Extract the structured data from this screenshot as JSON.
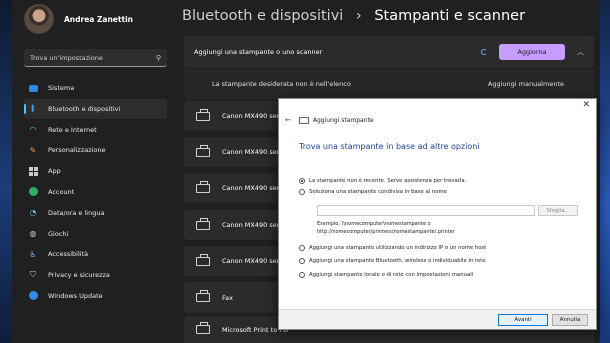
{
  "profile": {
    "name": "Andrea Zanettin"
  },
  "search": {
    "placeholder": "Trova un'impostazione"
  },
  "sidebar": {
    "items": [
      {
        "label": "Sistema",
        "icon": "system-icon"
      },
      {
        "label": "Bluetooth e dispositivi",
        "icon": "bluetooth-icon",
        "active": true
      },
      {
        "label": "Rete e Internet",
        "icon": "wifi-icon"
      },
      {
        "label": "Personalizzazione",
        "icon": "brush-icon"
      },
      {
        "label": "App",
        "icon": "apps-icon"
      },
      {
        "label": "Account",
        "icon": "account-icon"
      },
      {
        "label": "Data/ora e lingua",
        "icon": "globe-clock-icon"
      },
      {
        "label": "Giochi",
        "icon": "gamepad-icon"
      },
      {
        "label": "Accessibilità",
        "icon": "accessibility-icon"
      },
      {
        "label": "Privacy e sicurezza",
        "icon": "shield-icon"
      },
      {
        "label": "Windows Update",
        "icon": "update-icon"
      }
    ]
  },
  "breadcrumb": {
    "parent": "Bluetooth e dispositivi",
    "separator": "›",
    "current": "Stampanti e scanner"
  },
  "add_section": {
    "label": "Aggiungi una stampante o uno scanner",
    "refresh_button": "Aggiorna",
    "manual_text": "La stampante desiderata non è nell'elenco",
    "manual_button": "Aggiungi manualmente"
  },
  "printers": [
    {
      "name": "Canon MX490 series"
    },
    {
      "name": "Canon MX490 series"
    },
    {
      "name": "Canon MX490 series"
    },
    {
      "name": "Canon MX490 series"
    },
    {
      "name": "Canon MX490 series"
    },
    {
      "name": "Fax"
    },
    {
      "name": "Microsoft Print to PD"
    }
  ],
  "dialog": {
    "close": "✕",
    "title": "Aggiungi stampante",
    "heading": "Trova una stampante in base ad altre opzioni",
    "options": [
      {
        "label": "La stampante non è recente. Serve assistenza per trovarla.",
        "selected": true
      },
      {
        "label": "Seleziona una stampante condivisa in base al nome",
        "selected": false
      }
    ],
    "browse_button": "Sfoglia...",
    "example_line1": "Esempio: \\\\nomecomputer\\nomestampante o",
    "example_line2": "http://nomecomputer/printers/nomestampante/.printer",
    "options2": [
      {
        "label": "Aggiungi una stampante utilizzando un indirizzo IP o un nome host",
        "selected": false
      },
      {
        "label": "Aggiungi una stampante Bluetooth, wireless o individuabile in rete",
        "selected": false
      },
      {
        "label": "Aggiungi stampante locale o di rete con impostazioni manuali",
        "selected": false
      }
    ],
    "next_button": "Avanti",
    "cancel_button": "Annulla"
  },
  "colors": {
    "accent": "#c69cff",
    "link_blue": "#1d3f96",
    "selection_bar": "#4cc2ff"
  }
}
